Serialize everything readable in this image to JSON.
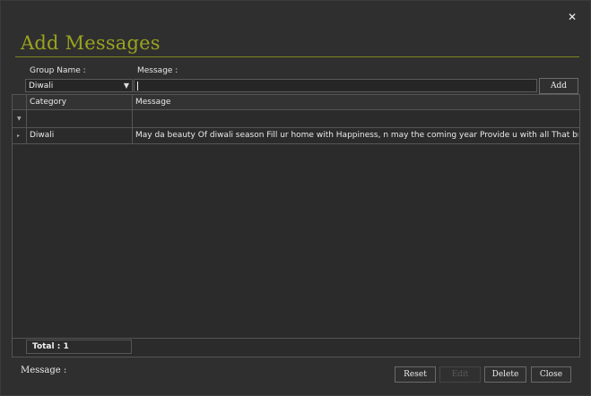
{
  "window": {
    "close_glyph": "✕",
    "title": "Add Messages"
  },
  "form": {
    "group_label": "Group Name :",
    "message_label": "Message :",
    "group_value": "Diwali",
    "message_value": "",
    "add_label": "Add"
  },
  "grid": {
    "columns": [
      "Category",
      "Message"
    ],
    "filter_glyph": "▼",
    "rows": [
      {
        "category": "Diwali",
        "message": "May da beauty Of diwali season Fill ur home with Happiness, n may the coming year Provide u with all That bring you joy!"
      }
    ],
    "total": "Total : 1"
  },
  "footer": {
    "status_label": "Message :",
    "reset_label": "Reset",
    "edit_label": "Edit",
    "delete_label": "Delete",
    "close_label": "Close"
  },
  "colors": {
    "accent": "#9aa31f",
    "background": "#2f2f2f",
    "border": "#555555"
  },
  "icons": {
    "close": "close-icon",
    "dropdown": "chevron-down-icon",
    "row_indicator": "row-arrow-icon"
  }
}
